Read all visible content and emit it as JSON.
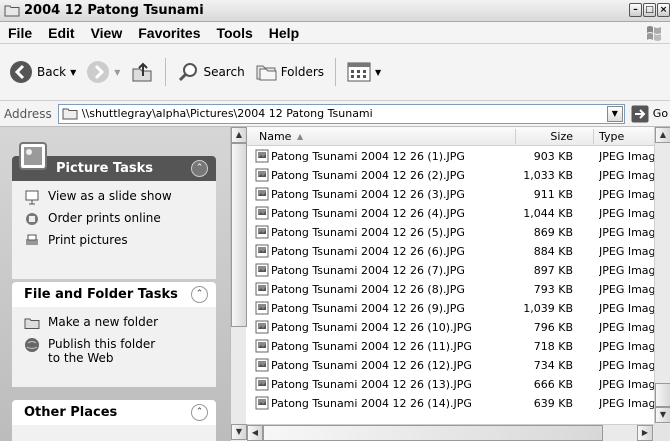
{
  "window": {
    "title": "2004 12 Patong Tsunami"
  },
  "menu": [
    "File",
    "Edit",
    "View",
    "Favorites",
    "Tools",
    "Help"
  ],
  "toolbar": {
    "back": "Back",
    "search": "Search",
    "folders": "Folders"
  },
  "address": {
    "label": "Address",
    "path": "\\\\shuttlegray\\alpha\\Pictures\\2004 12 Patong Tsunami",
    "go": "Go"
  },
  "panels": {
    "picture_tasks": {
      "title": "Picture Tasks",
      "items": [
        "View as a slide show",
        "Order prints online",
        "Print pictures"
      ]
    },
    "file_folder_tasks": {
      "title": "File and Folder Tasks",
      "items": [
        "Make a new folder",
        "Publish this folder to the Web"
      ]
    },
    "other_places": {
      "title": "Other Places"
    }
  },
  "columns": {
    "name": "Name",
    "size": "Size",
    "type": "Type"
  },
  "files": [
    {
      "name": "Patong Tsunami 2004 12 26 (1).JPG",
      "size": "903 KB",
      "type": "JPEG Imag"
    },
    {
      "name": "Patong Tsunami 2004 12 26 (2).JPG",
      "size": "1,033 KB",
      "type": "JPEG Imag"
    },
    {
      "name": "Patong Tsunami 2004 12 26 (3).JPG",
      "size": "911 KB",
      "type": "JPEG Imag"
    },
    {
      "name": "Patong Tsunami 2004 12 26 (4).JPG",
      "size": "1,044 KB",
      "type": "JPEG Imag"
    },
    {
      "name": "Patong Tsunami 2004 12 26 (5).JPG",
      "size": "869 KB",
      "type": "JPEG Imag"
    },
    {
      "name": "Patong Tsunami 2004 12 26 (6).JPG",
      "size": "884 KB",
      "type": "JPEG Imag"
    },
    {
      "name": "Patong Tsunami 2004 12 26 (7).JPG",
      "size": "897 KB",
      "type": "JPEG Imag"
    },
    {
      "name": "Patong Tsunami 2004 12 26 (8).JPG",
      "size": "793 KB",
      "type": "JPEG Imag"
    },
    {
      "name": "Patong Tsunami 2004 12 26 (9).JPG",
      "size": "1,039 KB",
      "type": "JPEG Imag"
    },
    {
      "name": "Patong Tsunami 2004 12 26 (10).JPG",
      "size": "796 KB",
      "type": "JPEG Imag"
    },
    {
      "name": "Patong Tsunami 2004 12 26 (11).JPG",
      "size": "718 KB",
      "type": "JPEG Imag"
    },
    {
      "name": "Patong Tsunami 2004 12 26 (12).JPG",
      "size": "734 KB",
      "type": "JPEG Imag"
    },
    {
      "name": "Patong Tsunami 2004 12 26 (13).JPG",
      "size": "666 KB",
      "type": "JPEG Imag"
    },
    {
      "name": "Patong Tsunami 2004 12 26 (14).JPG",
      "size": "639 KB",
      "type": "JPEG Imag"
    }
  ],
  "icons": {
    "folder": "folder-icon",
    "back": "back-arrow-icon",
    "forward": "forward-arrow-icon",
    "up": "up-folder-icon",
    "search": "search-icon",
    "folders": "folders-icon",
    "views": "views-icon",
    "go": "go-arrow-icon",
    "file": "jpeg-file-icon"
  }
}
